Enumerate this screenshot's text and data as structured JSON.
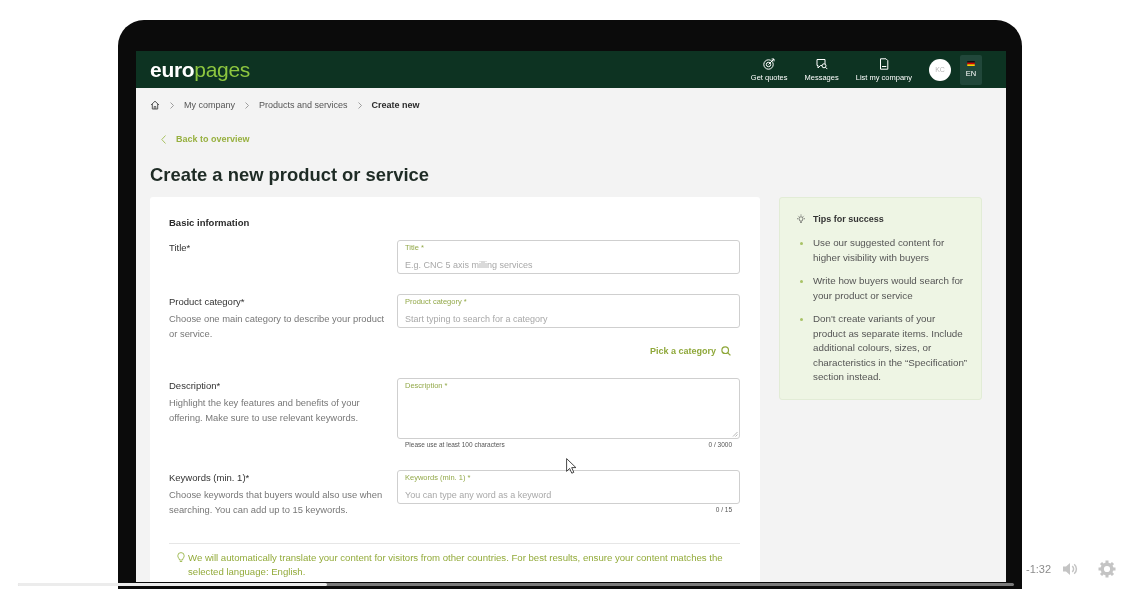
{
  "header": {
    "logo": "**euro**pages",
    "nav": [
      {
        "kind": "quotes",
        "label": "Get quotes"
      },
      {
        "kind": "messages",
        "label": "Messages"
      },
      {
        "kind": "listing",
        "label": "List my company"
      }
    ],
    "avatar": "KC",
    "language": "EN"
  },
  "breadcrumb": [
    {
      "label": "My company",
      "current": false
    },
    {
      "label": "Products and services",
      "current": false
    },
    {
      "label": "Create new",
      "current": true
    }
  ],
  "back_link": "Back to overview",
  "heading": "Create a new product or service",
  "form": {
    "section_title": "Basic information",
    "fields": [
      {
        "kind": "input",
        "label": "Title*",
        "floating_label": "Title *",
        "placeholder": "E.g. CNC 5 axis milling services"
      },
      {
        "kind": "input",
        "label": "Product category*",
        "help": "Choose one main category to describe your product or service.",
        "floating_label": "Product category *",
        "placeholder": "Start typing to search for a category",
        "link": "Pick a category"
      },
      {
        "kind": "textarea",
        "label": "Description*",
        "help": "Highlight the key features and benefits of your offering. Make sure to use relevant keywords.",
        "floating_label": "Description *",
        "hint": "Please use at least 100 characters",
        "counter": "0 / 3000"
      },
      {
        "kind": "input",
        "label": "Keywords (min. 1)*",
        "help": "Choose keywords that buyers would also use when searching. You can add up to 15 keywords.",
        "floating_label": "Keywords (min. 1) *",
        "placeholder": "You can type any word as a keyword",
        "counter": "0 / 15"
      }
    ],
    "notice": "We will automatically translate your content for visitors from other countries. For best results, ensure your content matches the selected language: English."
  },
  "tips": {
    "title": "Tips for success",
    "items": [
      "Use our suggested content for higher visibility with buyers",
      "Write how buyers would search for your product or service",
      "Don't create variants of your product as separate items. Include additional colours, sizes, or characteristics in the “Specification” section instead."
    ]
  },
  "video_player": {
    "progress": {
      "level": 0.31
    },
    "time": "-1:32"
  }
}
